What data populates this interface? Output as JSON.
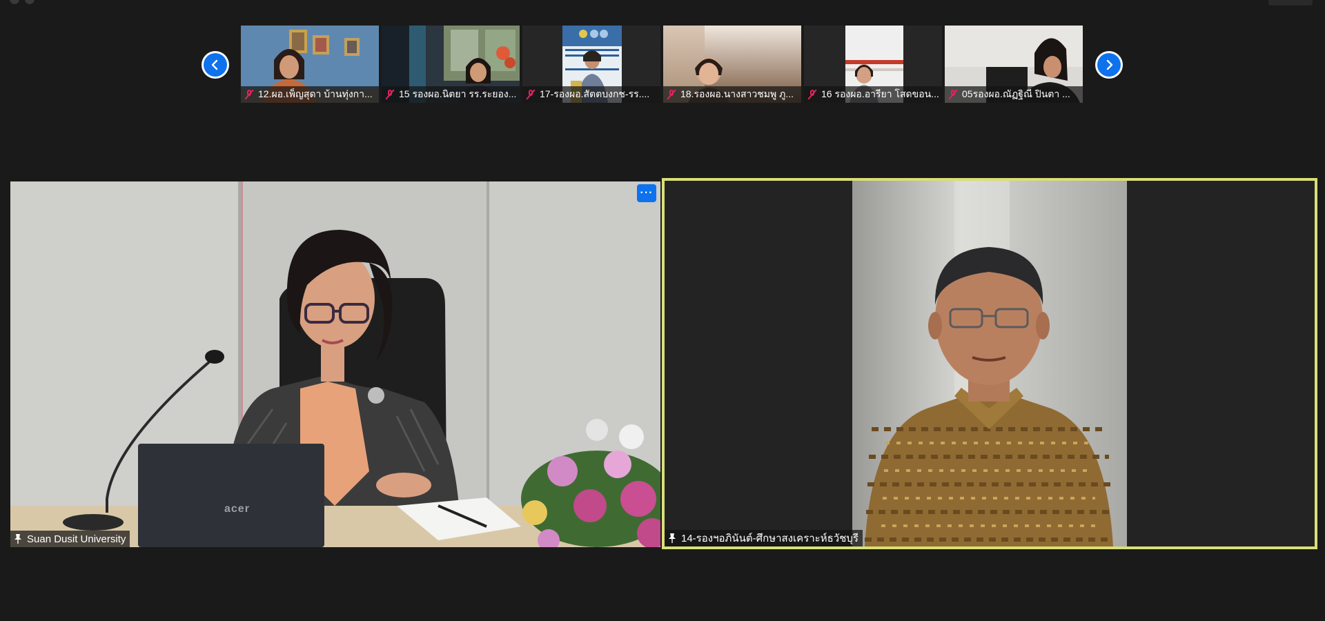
{
  "filmstrip": {
    "participants": [
      {
        "name": "12.ผอ.เพ็ญสุดา บ้านทุ่งกา...",
        "muted": true,
        "bg": "#5d86ac"
      },
      {
        "name": "15 รองผอ.นิตยา  รร.ระยอง...",
        "muted": true,
        "bg": "#3c4a55"
      },
      {
        "name": "17-รองผอ.สัตตบงกช-รร....",
        "muted": true,
        "bg": "#262626"
      },
      {
        "name": "18.รองผอ.นางสาวชมพู  ภู...",
        "muted": true,
        "bg": "#8b7560"
      },
      {
        "name": "16 รองผอ.อารียา  โสดขอน...",
        "muted": true,
        "bg": "#262626"
      },
      {
        "name": "05รองผอ.ณัฏฐิณี  ปินตา ...",
        "muted": true,
        "bg": "#d8d6d2"
      }
    ],
    "prev_icon": "chevron-left-icon",
    "next_icon": "chevron-right-icon"
  },
  "main_tiles": {
    "left": {
      "name": "Suan Dusit University",
      "pin_icon": "pin-icon",
      "more_label": "···",
      "laptop_brand": "acer"
    },
    "right": {
      "name": "14-รองฯอภินันต์-ศึกษาสงเคราะห์ธวัชบุรี",
      "pin_icon": "pin-icon",
      "active_speaker_color": "#d9df77"
    }
  },
  "colors": {
    "background": "#1a1a1a",
    "accent": "#0e72ed",
    "mute": "#e0245e"
  }
}
